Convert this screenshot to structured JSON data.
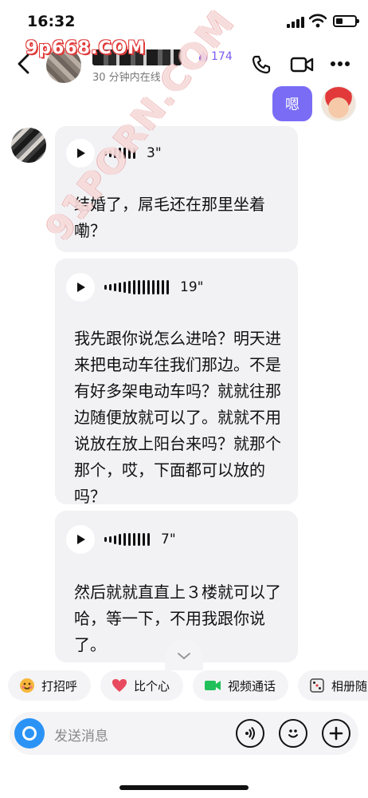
{
  "status_bar": {
    "time": "16:32",
    "battery_level": 0.35
  },
  "header": {
    "subtitle": "30 分钟内在线",
    "flame_count": "174",
    "icons": [
      "back-icon",
      "flame-icon",
      "phone-icon",
      "video-camera-icon",
      "more-icon"
    ]
  },
  "watermarks": {
    "top": "9p668.COM",
    "diagonal": "91PORN.COM"
  },
  "messages": [
    {
      "from": "me",
      "type": "text",
      "text": "嗯"
    },
    {
      "from": "peer",
      "type": "voice",
      "duration": "3\"",
      "transcript": "结婚了，屌毛还在那里坐着嘞？"
    },
    {
      "from": "peer",
      "type": "voice",
      "duration": "19\"",
      "transcript": "我先跟你说怎么进哈？明天进来把电动车往我们那边。不是有好多架电动车吗？就就往那边随便放就可以了。就就不用说放在放上阳台来吗？就那个那个，哎，下面都可以放的吗？"
    },
    {
      "from": "peer",
      "type": "voice",
      "duration": "7\"",
      "transcript": "然后就就直直上３楼就可以了哈，等一下，不用我跟你说了。"
    }
  ],
  "quick_chips": [
    {
      "label": "打招呼",
      "icon": "smile-emoji-icon"
    },
    {
      "label": "比个心",
      "icon": "heart-icon"
    },
    {
      "label": "视频通话",
      "icon": "video-icon"
    },
    {
      "label": "相册随",
      "icon": "dice-icon"
    }
  ],
  "composer": {
    "placeholder": "发送消息",
    "icons": [
      "camera-icon",
      "voice-icon",
      "emoji-icon",
      "plus-icon"
    ]
  },
  "colors": {
    "accent": "#7a6cf5",
    "bubble_bg": "#f2f2f5",
    "camera_blue": "#2b93f5",
    "heart_red": "#e84a5f",
    "video_green": "#22c05a"
  }
}
